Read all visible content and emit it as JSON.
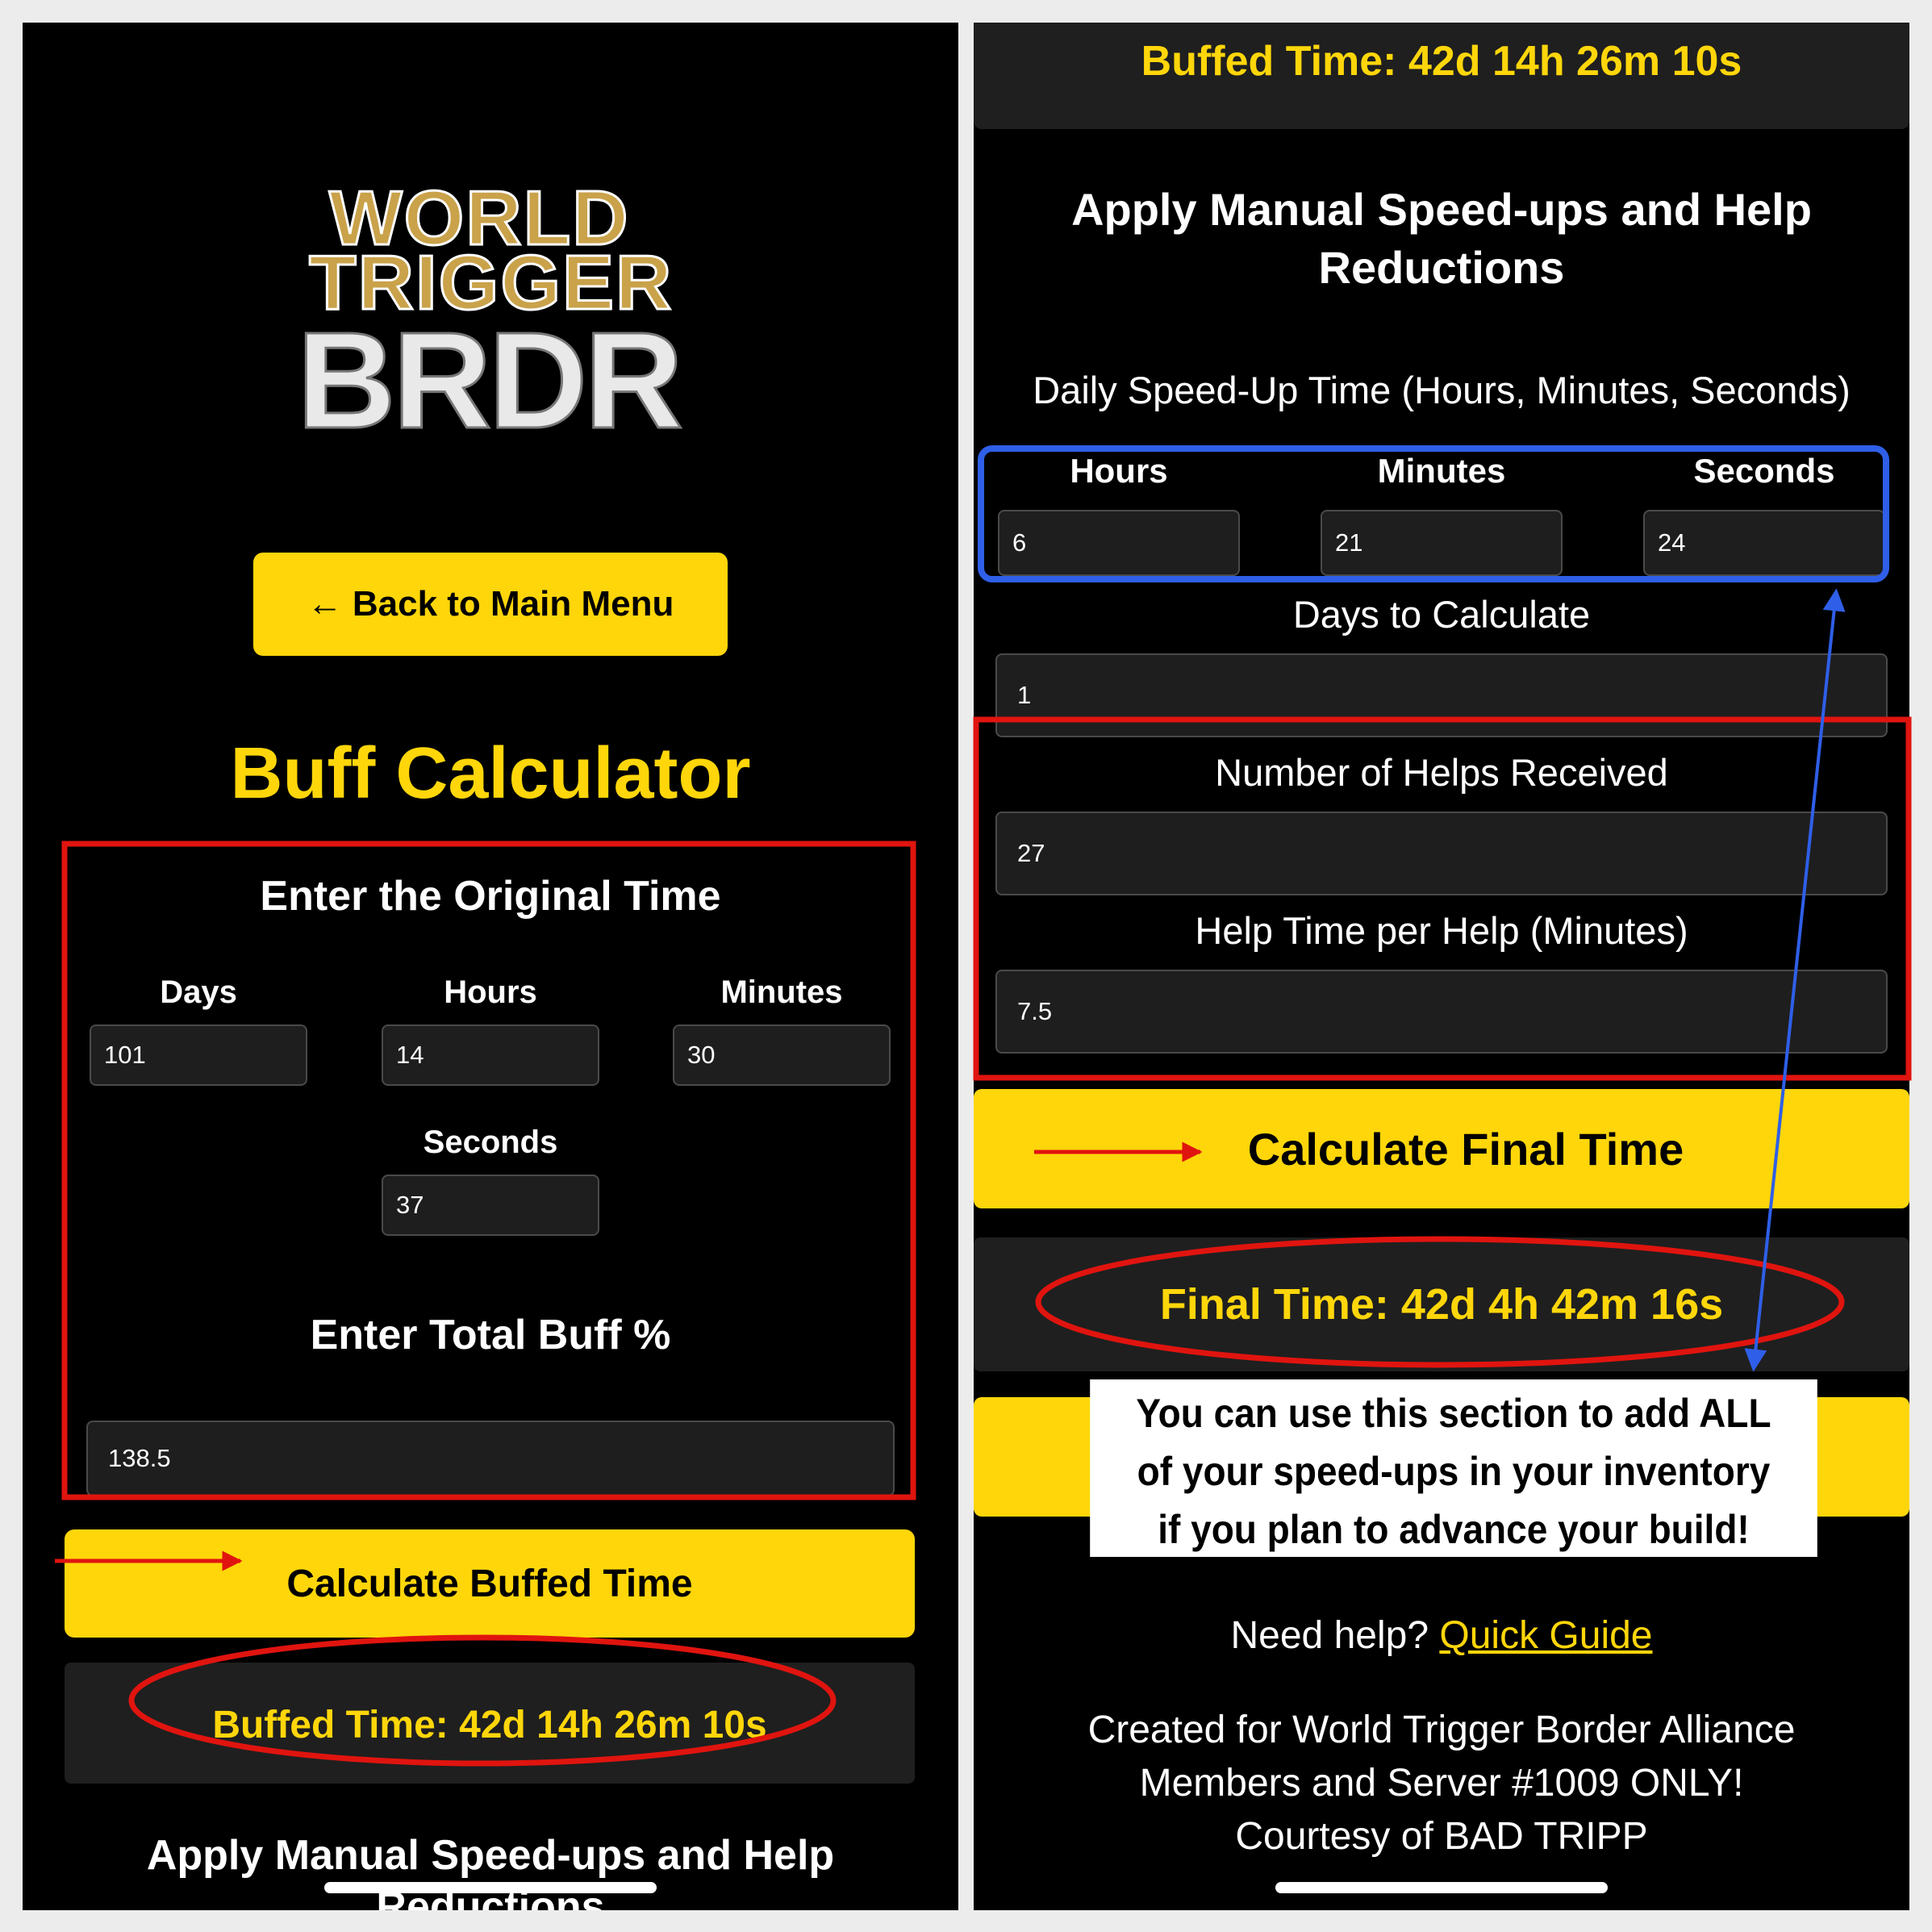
{
  "left": {
    "logo": {
      "line1": "WORLD",
      "line2": "TRIGGER",
      "line3": "BRDR"
    },
    "back_button": "← Back to Main Menu",
    "title": "Buff Calculator",
    "original_time_heading": "Enter the Original Time",
    "fields": {
      "days_label": "Days",
      "days_value": "101",
      "hours_label": "Hours",
      "hours_value": "14",
      "minutes_label": "Minutes",
      "minutes_value": "30",
      "seconds_label": "Seconds",
      "seconds_value": "37"
    },
    "buff_heading": "Enter Total Buff %",
    "buff_value": "138.5",
    "calc_button": "Calculate Buffed Time",
    "result": "Buffed Time: 42d 14h 26m 10s",
    "footer_heading": "Apply Manual Speed-ups and Help Reductions"
  },
  "right": {
    "top_result": "Buffed Time: 42d 14h 26m 10s",
    "heading_line1": "Apply Manual Speed-ups and Help",
    "heading_line2": "Reductions",
    "daily_label": "Daily Speed-Up Time (Hours, Minutes, Seconds)",
    "hours_label": "Hours",
    "hours_value": "6",
    "minutes_label": "Minutes",
    "minutes_value": "21",
    "seconds_label": "Seconds",
    "seconds_value": "24",
    "days_label": "Days to Calculate",
    "days_value": "1",
    "helps_label": "Number of Helps Received",
    "helps_value": "27",
    "help_time_label": "Help Time per Help (Minutes)",
    "help_time_value": "7.5",
    "calc_button": "Calculate Final Time",
    "final_result": "Final Time: 42d 4h 42m 16s",
    "callout_line1": "You can use this section to add ALL",
    "callout_line2": "of your speed-ups in your inventory",
    "callout_line3": "if you plan to advance your build!",
    "help_text": "Need help?",
    "quick_guide": "Quick Guide",
    "credits_line1": "Created for World Trigger Border Alliance",
    "credits_line2": "Members and Server #1009 ONLY!",
    "credits_line3": "Courtesy of BAD TRIPP"
  },
  "colors": {
    "accent": "#ffd60a",
    "annotation_red": "#e0140f",
    "annotation_blue": "#2f5fe8",
    "field_bg": "#1e1e1e"
  }
}
